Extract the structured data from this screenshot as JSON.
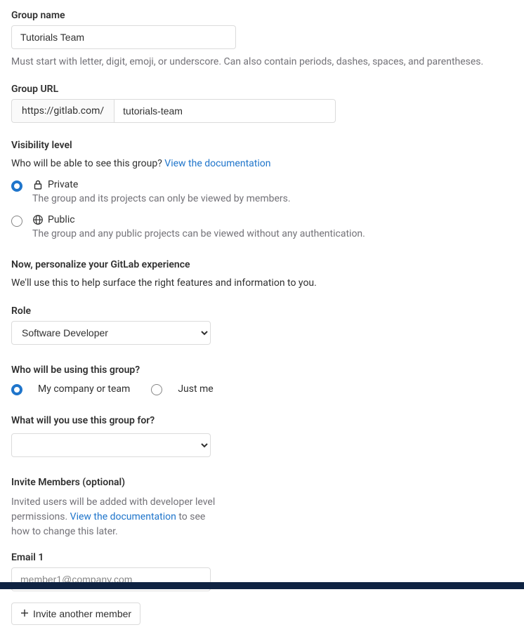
{
  "group_name": {
    "label": "Group name",
    "value": "Tutorials Team",
    "hint": "Must start with letter, digit, emoji, or underscore. Can also contain periods, dashes, spaces, and parentheses."
  },
  "group_url": {
    "label": "Group URL",
    "prefix": "https://gitlab.com/",
    "value": "tutorials-team"
  },
  "visibility": {
    "heading": "Visibility level",
    "question": "Who will be able to see this group? ",
    "doc_link": "View the documentation",
    "options": [
      {
        "id": "private",
        "title": "Private",
        "desc": "The group and its projects can only be viewed by members.",
        "selected": true
      },
      {
        "id": "public",
        "title": "Public",
        "desc": "The group and any public projects can be viewed without any authentication.",
        "selected": false
      }
    ]
  },
  "personalize": {
    "heading": "Now, personalize your GitLab experience",
    "sub": "We'll use this to help surface the right features and information to you."
  },
  "role": {
    "label": "Role",
    "selected": "Software Developer"
  },
  "who_using": {
    "label": "Who will be using this group?",
    "options": [
      {
        "label": "My company or team",
        "selected": true
      },
      {
        "label": "Just me",
        "selected": false
      }
    ]
  },
  "use_for": {
    "label": "What will you use this group for?",
    "selected": ""
  },
  "invite": {
    "heading": "Invite Members (optional)",
    "hint_pre": "Invited users will be added with developer level permissions. ",
    "doc_link": "View the documentation",
    "hint_post": " to see how to change this later.",
    "email_label": "Email 1",
    "email_placeholder": "member1@company.com",
    "button": "Invite another member"
  }
}
